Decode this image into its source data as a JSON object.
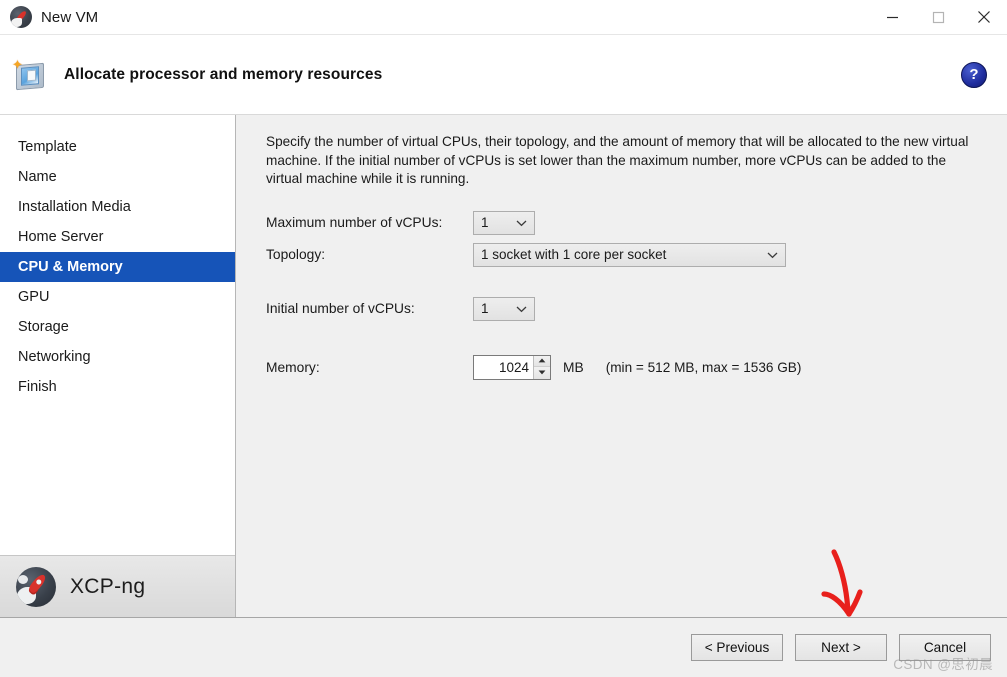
{
  "titlebar": {
    "title": "New VM",
    "icon": "xcp-ng-rocket-icon",
    "minimize": "—",
    "maximize": "□",
    "close": "✕"
  },
  "header": {
    "title": "Allocate processor and memory resources",
    "icon": "new-vm-wizard-icon",
    "help": "?"
  },
  "sidebar": {
    "items": [
      {
        "label": "Template",
        "selected": false
      },
      {
        "label": "Name",
        "selected": false
      },
      {
        "label": "Installation Media",
        "selected": false
      },
      {
        "label": "Home Server",
        "selected": false
      },
      {
        "label": "CPU & Memory",
        "selected": true
      },
      {
        "label": "GPU",
        "selected": false
      },
      {
        "label": "Storage",
        "selected": false
      },
      {
        "label": "Networking",
        "selected": false
      },
      {
        "label": "Finish",
        "selected": false
      }
    ],
    "brand": "XCP-ng",
    "selected_color": "#1654b8"
  },
  "content": {
    "description": "Specify the number of virtual CPUs, their topology, and the amount of memory that will be allocated to the new virtual machine. If the initial number of vCPUs is set lower than the maximum number, more vCPUs can be added to the virtual machine while it is running.",
    "fields": {
      "max_vcpus_label": "Maximum number of vCPUs:",
      "max_vcpus_value": "1",
      "topology_label": "Topology:",
      "topology_value": "1 socket with 1 core per socket",
      "initial_vcpus_label": "Initial number of vCPUs:",
      "initial_vcpus_value": "1",
      "memory_label": "Memory:",
      "memory_value": "1024",
      "memory_unit": "MB",
      "memory_hint": "(min = 512 MB, max = 1536 GB)"
    }
  },
  "footer": {
    "previous": "< Previous",
    "next": "Next >",
    "cancel": "Cancel"
  },
  "watermark": "CSDN @思初晨"
}
